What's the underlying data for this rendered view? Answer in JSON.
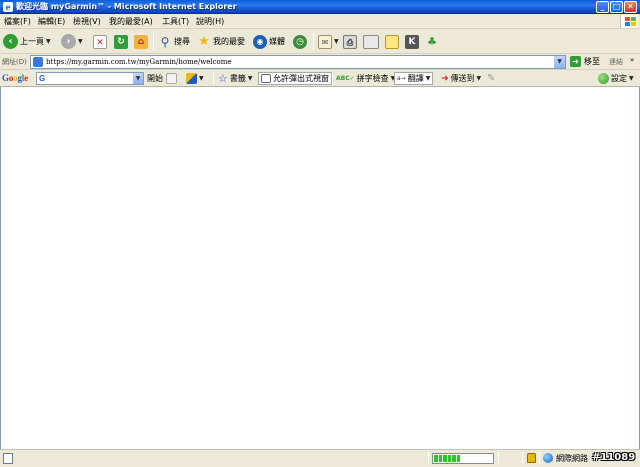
{
  "window": {
    "title": "歡迎光臨 myGarmin™ - Microsoft Internet Explorer",
    "controls": [
      "minimize",
      "maximize",
      "close"
    ]
  },
  "menu": {
    "items": [
      {
        "label": "檔案(F)"
      },
      {
        "label": "編輯(E)"
      },
      {
        "label": "檢視(V)"
      },
      {
        "label": "我的最愛(A)"
      },
      {
        "label": "工具(T)"
      },
      {
        "label": "說明(H)"
      }
    ]
  },
  "toolbar": {
    "back_label": "上一頁",
    "search_label": "搜尋",
    "favorites_label": "我的最愛",
    "media_label": "媒體",
    "icons": [
      "back-icon",
      "forward-icon",
      "stop-icon",
      "refresh-icon",
      "home-icon",
      "search-icon",
      "favorites-star-icon",
      "media-icon",
      "history-icon",
      "mail-icon",
      "print-icon",
      "edit-icon",
      "discuss-icon",
      "research-icon",
      "messenger-icon"
    ]
  },
  "address_bar": {
    "label": "網址(D)",
    "url": "https://my.garmin.com.tw/myGarmin/home/welcome",
    "go_label": "移至",
    "links_label": "連結",
    "overflow": "»"
  },
  "google_toolbar": {
    "logo": "Google",
    "search_prefix": "G",
    "open_label": "開始",
    "bookmarks_label": "書籤",
    "popup_label": "允許彈出式視窗",
    "spellcheck_label": "拼字檢查",
    "translate_label": "翻譯",
    "send_to_label": "傳送到",
    "settings_label": "設定"
  },
  "status_bar": {
    "progress_fraction": 0.45,
    "progress_segments": 6,
    "zone_label": "網際網路"
  },
  "watermark": "#11089",
  "colors": {
    "titlebar": "#0a5fd8",
    "chrome": "#ece9d8",
    "progress": "#2fc22f",
    "close_button": "#c53c16"
  }
}
